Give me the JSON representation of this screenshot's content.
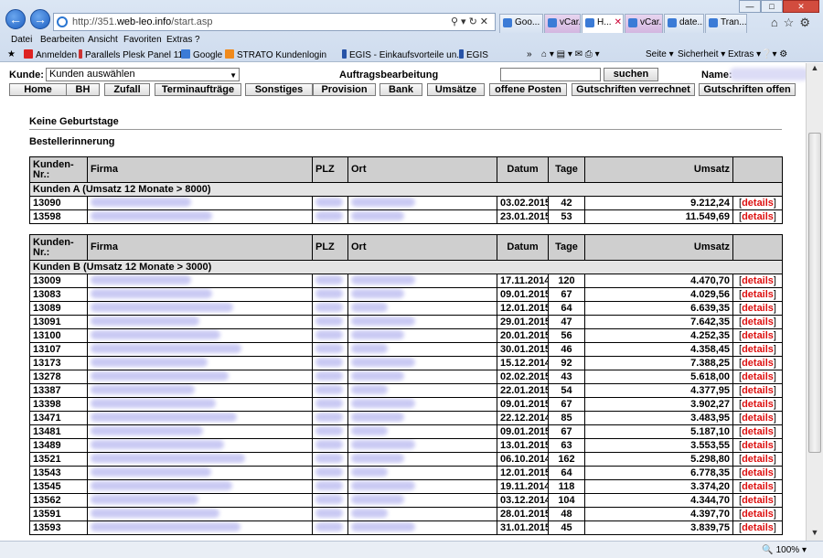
{
  "browser": {
    "url_prefix": "http://351.",
    "url_host": "web-leo.info",
    "url_path": "/start.asp",
    "tabs": [
      {
        "label": "Goo..."
      },
      {
        "label": "vCar..."
      },
      {
        "label": "H...",
        "active": true
      },
      {
        "label": "vCar..."
      },
      {
        "label": "date..."
      },
      {
        "label": "Tran..."
      }
    ],
    "menu": [
      "Datei",
      "Bearbeiten",
      "Ansicht",
      "Favoriten",
      "Extras",
      "?"
    ],
    "favorites": [
      "Anmelden",
      "Parallels Plesk Panel 11.0",
      "Google",
      "STRATO Kundenlogin",
      "EGIS - Einkaufsvorteile un...",
      "EGIS"
    ],
    "tools": {
      "seite": "Seite",
      "sicherheit": "Sicherheit",
      "extras": "Extras"
    },
    "zoom": "100%"
  },
  "app": {
    "kunde_label": "Kunde:",
    "kunde_select": "Kunden auswählen",
    "title": "Auftragsbearbeitung",
    "search_button": "suchen",
    "name_label": "Name:",
    "nav": [
      "Home",
      "BH",
      "Zufall",
      "Terminaufträge",
      "Sonstiges",
      "Provision",
      "Bank",
      "Umsätze",
      "offene Posten",
      "Gutschriften verrechnet",
      "Gutschriften offen"
    ]
  },
  "notes": {
    "birthdays": "Keine Geburtstage",
    "reminder": "Bestellerinnerung"
  },
  "columns": {
    "kunde": "Kunden-Nr.:",
    "firma": "Firma",
    "plz": "PLZ",
    "ort": "Ort",
    "datum": "Datum",
    "tage": "Tage",
    "umsatz": "Umsatz"
  },
  "details_label": "details",
  "group_a": {
    "title": "Kunden A (Umsatz 12 Monate > 8000)",
    "rows": [
      {
        "nr": "13090",
        "datum": "03.02.2015",
        "tage": "42",
        "umsatz": "9.212,24"
      },
      {
        "nr": "13598",
        "datum": "23.01.2015",
        "tage": "53",
        "umsatz": "11.549,69"
      }
    ]
  },
  "group_b": {
    "title": "Kunden B (Umsatz 12 Monate > 3000)",
    "rows": [
      {
        "nr": "13009",
        "datum": "17.11.2014",
        "tage": "120",
        "umsatz": "4.470,70"
      },
      {
        "nr": "13083",
        "datum": "09.01.2015",
        "tage": "67",
        "umsatz": "4.029,56"
      },
      {
        "nr": "13089",
        "datum": "12.01.2015",
        "tage": "64",
        "umsatz": "6.639,35"
      },
      {
        "nr": "13091",
        "datum": "29.01.2015",
        "tage": "47",
        "umsatz": "7.642,35"
      },
      {
        "nr": "13100",
        "datum": "20.01.2015",
        "tage": "56",
        "umsatz": "4.252,35"
      },
      {
        "nr": "13107",
        "datum": "30.01.2015",
        "tage": "46",
        "umsatz": "4.358,45"
      },
      {
        "nr": "13173",
        "datum": "15.12.2014",
        "tage": "92",
        "umsatz": "7.388,25"
      },
      {
        "nr": "13278",
        "datum": "02.02.2015",
        "tage": "43",
        "umsatz": "5.618,00"
      },
      {
        "nr": "13387",
        "datum": "22.01.2015",
        "tage": "54",
        "umsatz": "4.377,95"
      },
      {
        "nr": "13398",
        "datum": "09.01.2015",
        "tage": "67",
        "umsatz": "3.902,27"
      },
      {
        "nr": "13471",
        "datum": "22.12.2014",
        "tage": "85",
        "umsatz": "3.483,95"
      },
      {
        "nr": "13481",
        "datum": "09.01.2015",
        "tage": "67",
        "umsatz": "5.187,10"
      },
      {
        "nr": "13489",
        "datum": "13.01.2015",
        "tage": "63",
        "umsatz": "3.553,55"
      },
      {
        "nr": "13521",
        "datum": "06.10.2014",
        "tage": "162",
        "umsatz": "5.298,80"
      },
      {
        "nr": "13543",
        "datum": "12.01.2015",
        "tage": "64",
        "umsatz": "6.778,35"
      },
      {
        "nr": "13545",
        "datum": "19.11.2014",
        "tage": "118",
        "umsatz": "3.374,20"
      },
      {
        "nr": "13562",
        "datum": "03.12.2014",
        "tage": "104",
        "umsatz": "4.344,70"
      },
      {
        "nr": "13591",
        "datum": "28.01.2015",
        "tage": "48",
        "umsatz": "4.397,70"
      },
      {
        "nr": "13593",
        "datum": "31.01.2015",
        "tage": "45",
        "umsatz": "3.839,75"
      }
    ]
  }
}
